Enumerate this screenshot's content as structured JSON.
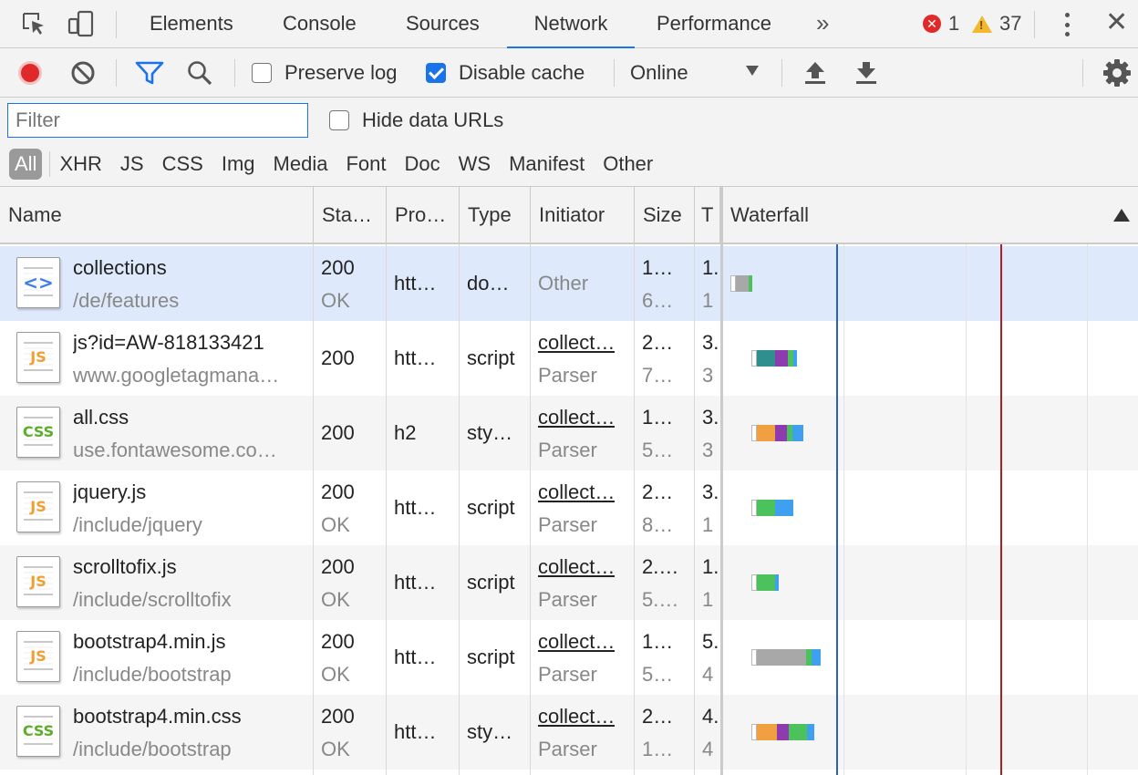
{
  "tabs": {
    "items": [
      "Elements",
      "Console",
      "Sources",
      "Network",
      "Performance"
    ],
    "active": "Network",
    "more": "»",
    "errors": "1",
    "warnings": "37"
  },
  "toolbar": {
    "preserve_log": "Preserve log",
    "preserve_log_checked": false,
    "disable_cache": "Disable cache",
    "disable_cache_checked": true,
    "throttling": "Online"
  },
  "filter": {
    "placeholder": "Filter",
    "value": "",
    "hide_data_urls": "Hide data URLs",
    "types": [
      "All",
      "XHR",
      "JS",
      "CSS",
      "Img",
      "Media",
      "Font",
      "Doc",
      "WS",
      "Manifest",
      "Other"
    ],
    "active_type": "All"
  },
  "columns": [
    "Name",
    "Sta…",
    "Pro…",
    "Type",
    "Initiator",
    "Size",
    "T",
    "Waterfall"
  ],
  "rows": [
    {
      "icon": "document-icon",
      "badge": "<>",
      "name": "collections",
      "path": "/de/features",
      "status": "200",
      "status_text": "OK",
      "protocol": "htt…",
      "type": "do…",
      "initiator": "Other",
      "initiator_sub": "",
      "size1": "1…",
      "size2": "6…",
      "time1": "1.",
      "time2": "1"
    },
    {
      "icon": "js-file-icon",
      "badge": "JS",
      "name": "js?id=AW-818133421",
      "path": "www.googletagmana…",
      "status": "200",
      "status_text": "",
      "protocol": "htt…",
      "type": "script",
      "initiator": "collect…",
      "initiator_sub": "Parser",
      "size1": "2…",
      "size2": "7…",
      "time1": "3.",
      "time2": "3"
    },
    {
      "icon": "css-file-icon",
      "badge": "CSS",
      "name": "all.css",
      "path": "use.fontawesome.co…",
      "status": "200",
      "status_text": "",
      "protocol": "h2",
      "type": "sty…",
      "initiator": "collect…",
      "initiator_sub": "Parser",
      "size1": "1…",
      "size2": "5…",
      "time1": "3.",
      "time2": "3"
    },
    {
      "icon": "js-file-icon",
      "badge": "JS",
      "name": "jquery.js",
      "path": "/include/jquery",
      "status": "200",
      "status_text": "OK",
      "protocol": "htt…",
      "type": "script",
      "initiator": "collect…",
      "initiator_sub": "Parser",
      "size1": "2…",
      "size2": "8…",
      "time1": "3.",
      "time2": "1"
    },
    {
      "icon": "js-file-icon",
      "badge": "JS",
      "name": "scrolltofix.js",
      "path": "/include/scrolltofix",
      "status": "200",
      "status_text": "OK",
      "protocol": "htt…",
      "type": "script",
      "initiator": "collect…",
      "initiator_sub": "Parser",
      "size1": "2.…",
      "size2": "5.…",
      "time1": "1.",
      "time2": "1"
    },
    {
      "icon": "js-file-icon",
      "badge": "JS",
      "name": "bootstrap4.min.js",
      "path": "/include/bootstrap",
      "status": "200",
      "status_text": "OK",
      "protocol": "htt…",
      "type": "script",
      "initiator": "collect…",
      "initiator_sub": "Parser",
      "size1": "1…",
      "size2": "5…",
      "time1": "5.",
      "time2": "4"
    },
    {
      "icon": "css-file-icon",
      "badge": "CSS",
      "name": "bootstrap4.min.css",
      "path": "/include/bootstrap",
      "status": "200",
      "status_text": "OK",
      "protocol": "htt…",
      "type": "sty…",
      "initiator": "collect…",
      "initiator_sub": "Parser",
      "size1": "2…",
      "size2": "1…",
      "time1": "4.",
      "time2": "4"
    }
  ],
  "waterfall_colors": {
    "queue": "#ffffff",
    "stalled": "#a8a8a8",
    "dns": "#2f8f8f",
    "connect": "#f0a040",
    "ssl": "#8e3bb0",
    "waiting": "#4cc25c",
    "download": "#3fa0f0",
    "dom_content_loaded": "#2c5fc0",
    "load": "#b02020"
  }
}
